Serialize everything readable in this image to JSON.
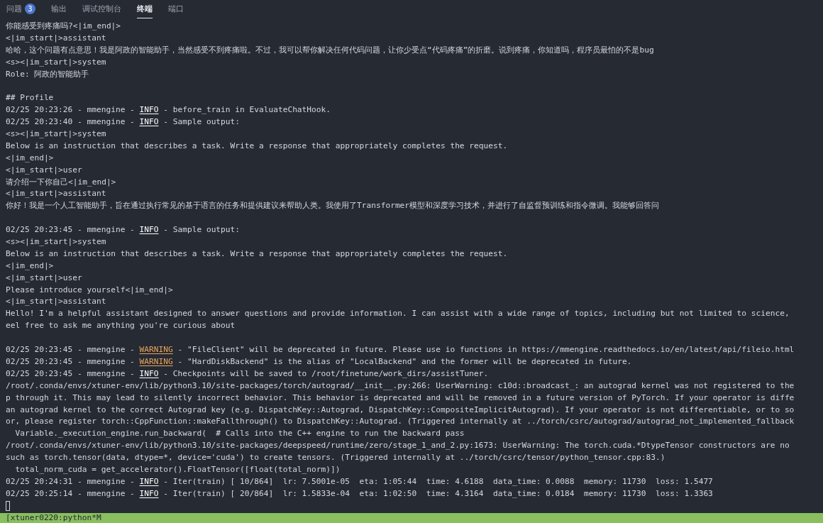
{
  "tabs": [
    {
      "label": "问题",
      "badge": "3",
      "selected": false
    },
    {
      "label": "输出",
      "selected": false
    },
    {
      "label": "调试控制台",
      "selected": false
    },
    {
      "label": "终端",
      "selected": true
    },
    {
      "label": "端口",
      "selected": false
    }
  ],
  "terminal": {
    "lines": [
      {
        "kind": "text",
        "text": "你能感受到疼痛吗?<|im_end|>"
      },
      {
        "kind": "text",
        "text": "<|im_start|>assistant"
      },
      {
        "kind": "text",
        "text": "哈哈，这个问题有点意思！我是阿政的智能助手，当然感受不到疼痛啦。不过，我可以帮你解决任何代码问题，让你少受点“代码疼痛”的折磨。说到疼痛，你知道吗，程序员最怕的不是bug"
      },
      {
        "kind": "text",
        "text": "<s><|im_start|>system"
      },
      {
        "kind": "text",
        "text": "Role: 阿政的智能助手"
      },
      {
        "kind": "blank"
      },
      {
        "kind": "text",
        "text": "## Profile"
      },
      {
        "kind": "log",
        "prefix": "02/25 20:23:26 - mmengine - ",
        "level": {
          "label": "INFO",
          "kind": "info"
        },
        "message": " - before_train in EvaluateChatHook."
      },
      {
        "kind": "log",
        "prefix": "02/25 20:23:40 - mmengine - ",
        "level": {
          "label": "INFO",
          "kind": "info"
        },
        "message": " - Sample output:"
      },
      {
        "kind": "text",
        "text": "<s><|im_start|>system"
      },
      {
        "kind": "text",
        "text": "Below is an instruction that describes a task. Write a response that appropriately completes the request."
      },
      {
        "kind": "text",
        "text": "<|im_end|>"
      },
      {
        "kind": "text",
        "text": "<|im_start|>user"
      },
      {
        "kind": "text",
        "text": "请介绍一下你自己<|im_end|>"
      },
      {
        "kind": "text",
        "text": "<|im_start|>assistant"
      },
      {
        "kind": "text",
        "text": "你好！我是一个人工智能助手，旨在通过执行常见的基于语言的任务和提供建议来帮助人类。我使用了Transformer模型和深度学习技术，并进行了自监督预训练和指令微调。我能够回答问"
      },
      {
        "kind": "blank"
      },
      {
        "kind": "log",
        "prefix": "02/25 20:23:45 - mmengine - ",
        "level": {
          "label": "INFO",
          "kind": "info"
        },
        "message": " - Sample output:"
      },
      {
        "kind": "text",
        "text": "<s><|im_start|>system"
      },
      {
        "kind": "text",
        "text": "Below is an instruction that describes a task. Write a response that appropriately completes the request."
      },
      {
        "kind": "text",
        "text": "<|im_end|>"
      },
      {
        "kind": "text",
        "text": "<|im_start|>user"
      },
      {
        "kind": "text",
        "text": "Please introduce yourself<|im_end|>"
      },
      {
        "kind": "text",
        "text": "<|im_start|>assistant"
      },
      {
        "kind": "text",
        "text": "Hello! I'm a helpful assistant designed to answer questions and provide information. I can assist with a wide range of topics, including but not limited to science,"
      },
      {
        "kind": "text",
        "text": "eel free to ask me anything you're curious about"
      },
      {
        "kind": "blank"
      },
      {
        "kind": "log",
        "prefix": "02/25 20:23:45 - mmengine - ",
        "level": {
          "label": "WARNING",
          "kind": "warning"
        },
        "message": " - \"FileClient\" will be deprecated in future. Please use io functions in https://mmengine.readthedocs.io/en/latest/api/fileio.html"
      },
      {
        "kind": "log",
        "prefix": "02/25 20:23:45 - mmengine - ",
        "level": {
          "label": "WARNING",
          "kind": "warning"
        },
        "message": " - \"HardDiskBackend\" is the alias of \"LocalBackend\" and the former will be deprecated in future."
      },
      {
        "kind": "log",
        "prefix": "02/25 20:23:45 - mmengine - ",
        "level": {
          "label": "INFO",
          "kind": "info"
        },
        "message": " - Checkpoints will be saved to /root/finetune/work_dirs/assistTuner."
      },
      {
        "kind": "text",
        "text": "/root/.conda/envs/xtuner-env/lib/python3.10/site-packages/torch/autograd/__init__.py:266: UserWarning: c10d::broadcast_: an autograd kernel was not registered to the"
      },
      {
        "kind": "text",
        "text": "p through it. This may lead to silently incorrect behavior. This behavior is deprecated and will be removed in a future version of PyTorch. If your operator is diffe"
      },
      {
        "kind": "text",
        "text": "an autograd kernel to the correct Autograd key (e.g. DispatchKey::Autograd, DispatchKey::CompositeImplicitAutograd). If your operator is not differentiable, or to so"
      },
      {
        "kind": "text",
        "text": "or, please register torch::CppFunction::makeFallthrough() to DispatchKey::Autograd. (Triggered internally at ../torch/csrc/autograd/autograd_not_implemented_fallback"
      },
      {
        "kind": "text",
        "text": "  Variable._execution_engine.run_backward(  # Calls into the C++ engine to run the backward pass"
      },
      {
        "kind": "text",
        "text": "/root/.conda/envs/xtuner-env/lib/python3.10/site-packages/deepspeed/runtime/zero/stage_1_and_2.py:1673: UserWarning: The torch.cuda.*DtypeTensor constructors are no"
      },
      {
        "kind": "text",
        "text": "such as torch.tensor(data, dtype=*, device='cuda') to create tensors. (Triggered internally at ../torch/csrc/tensor/python_tensor.cpp:83.)"
      },
      {
        "kind": "text",
        "text": "  total_norm_cuda = get_accelerator().FloatTensor([float(total_norm)])"
      },
      {
        "kind": "log",
        "prefix": "02/25 20:24:31 - mmengine - ",
        "level": {
          "label": "INFO",
          "kind": "info"
        },
        "message": " - Iter(train) [ 10/864]  lr: 7.5001e-05  eta: 1:05:44  time: 4.6188  data_time: 0.0088  memory: 11730  loss: 1.5477"
      },
      {
        "kind": "log",
        "prefix": "02/25 20:25:14 - mmengine - ",
        "level": {
          "label": "INFO",
          "kind": "info"
        },
        "message": " - Iter(train) [ 20/864]  lr: 1.5833e-04  eta: 1:02:50  time: 4.3164  data_time: 0.0184  memory: 11730  loss: 1.3363"
      },
      {
        "kind": "cursor"
      }
    ],
    "status_bar": "[xtuner0220:python*M"
  }
}
